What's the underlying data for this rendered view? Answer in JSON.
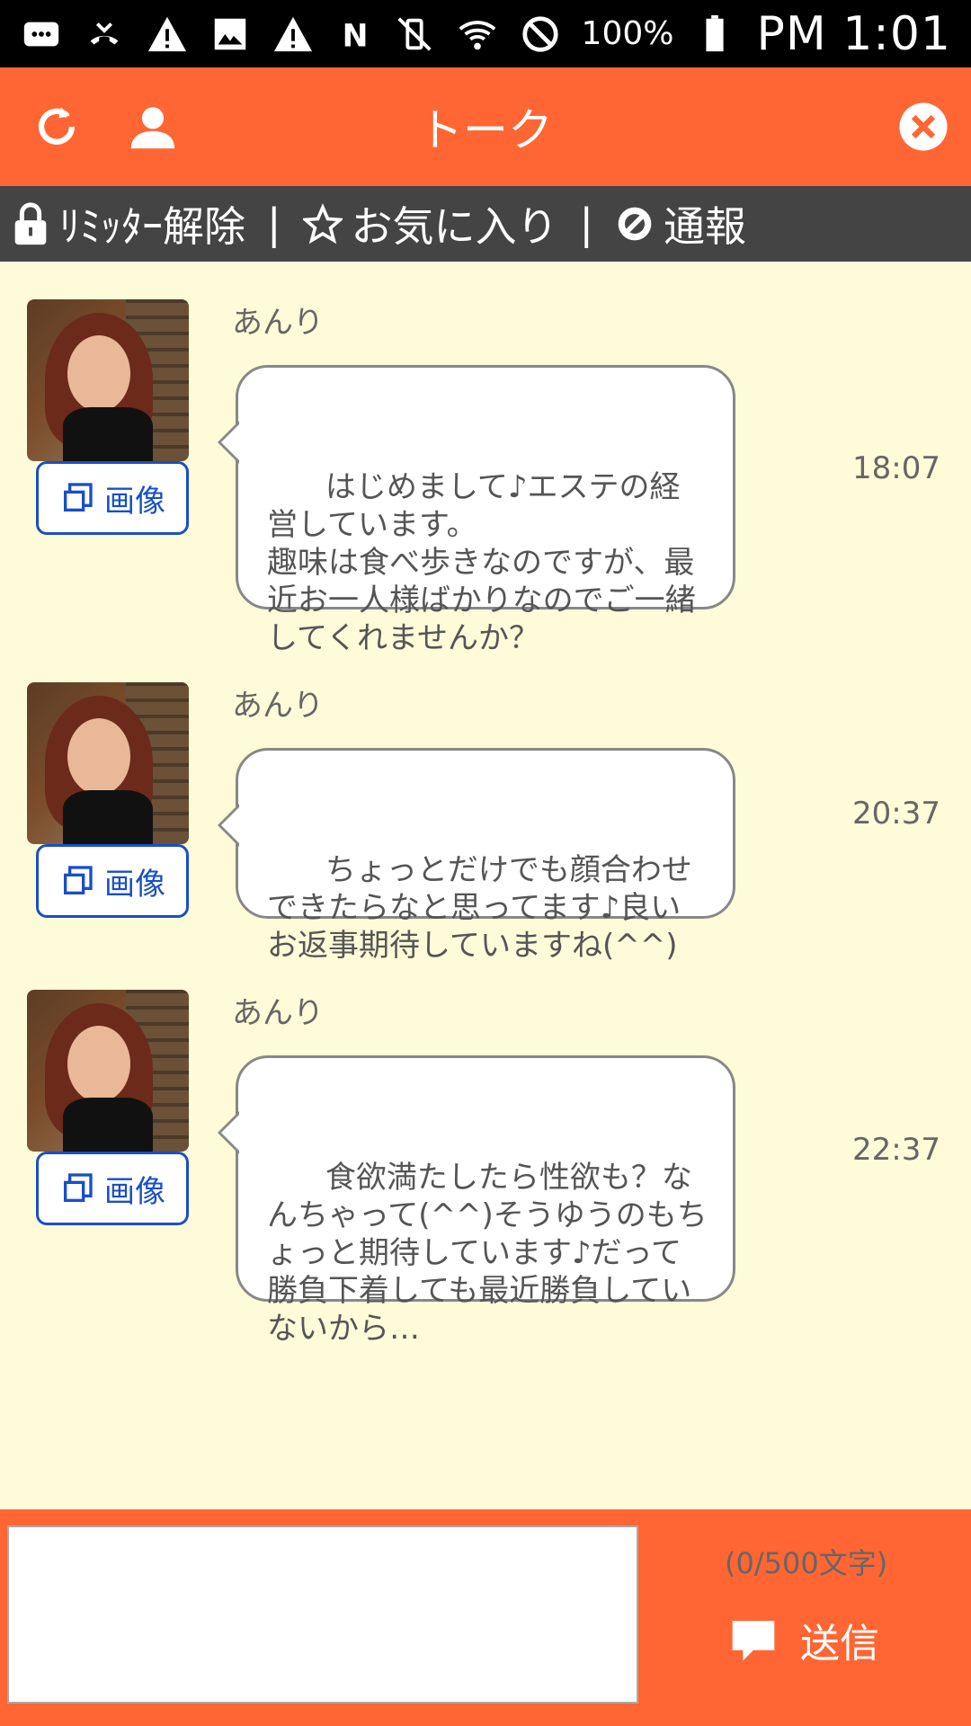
{
  "status_bar": {
    "battery": "100%",
    "time": "PM 1:01"
  },
  "header": {
    "title": "トーク"
  },
  "toolbar": {
    "limiter": "ﾘﾐｯﾀｰ解除",
    "separator": "|",
    "favorite": "お気に入り",
    "report": "通報"
  },
  "messages": [
    {
      "sender": "あんり",
      "text": "はじめまして♪エステの経営しています。\n趣味は食べ歩きなのですが、最近お一人様ばかりなのでご一緒してくれませんか？",
      "time": "18:07",
      "image_button": "画像"
    },
    {
      "sender": "あんり",
      "text": "ちょっとだけでも顔合わせできたらなと思ってます♪良いお返事期待していますね(^^)",
      "time": "20:37",
      "image_button": "画像"
    },
    {
      "sender": "あんり",
      "text": "食欲満たしたら性欲も？なんちゃって(^^)そうゆうのもちょっと期待しています♪だって勝負下着しても最近勝負していないから…",
      "time": "22:37",
      "image_button": "画像"
    }
  ],
  "footer": {
    "input_value": "",
    "char_count": "(0/500文字)",
    "send_label": "送信"
  },
  "colors": {
    "accent": "#ff6633",
    "toolbar": "#444444",
    "background": "#fefbd8",
    "link": "#1a4fc4"
  }
}
